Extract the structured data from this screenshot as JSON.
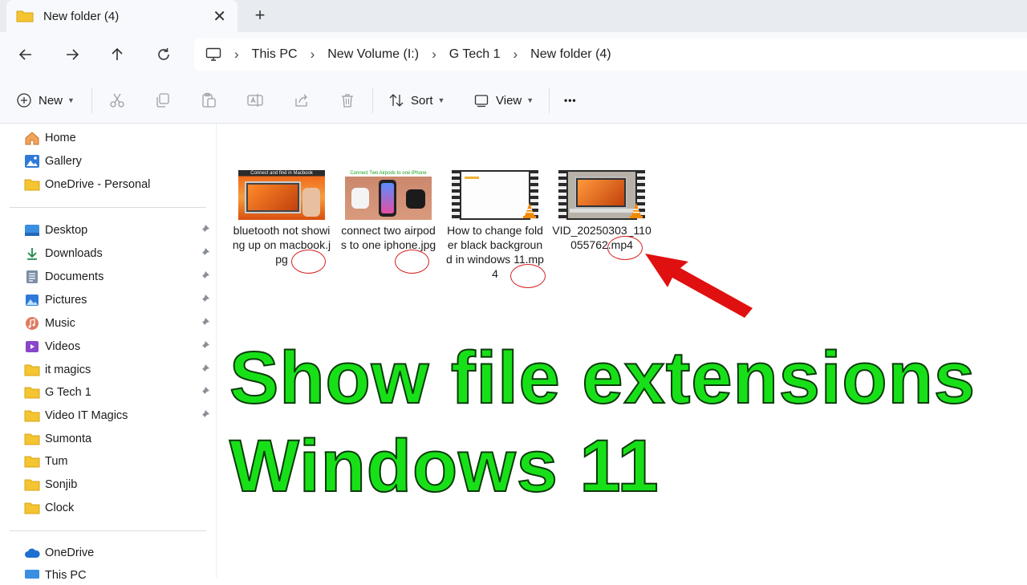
{
  "tab": {
    "title": "New folder (4)",
    "close": "✕",
    "new_tab": "+"
  },
  "address": {
    "crumbs": [
      "This PC",
      "New Volume (I:)",
      "G Tech 1",
      "New folder (4)"
    ],
    "separator": "›"
  },
  "toolbar": {
    "new_label": "New",
    "sort_label": "Sort",
    "view_label": "View",
    "more_label": "•••"
  },
  "sidebar": {
    "top_items": [
      {
        "label": "Home",
        "icon": "home-icon"
      },
      {
        "label": "Gallery",
        "icon": "gallery-icon"
      },
      {
        "label": "OneDrive - Personal",
        "icon": "folder-icon"
      }
    ],
    "pinned_items": [
      {
        "label": "Desktop",
        "icon": "desktop-icon",
        "pinned": true
      },
      {
        "label": "Downloads",
        "icon": "download-icon",
        "pinned": true
      },
      {
        "label": "Documents",
        "icon": "documents-icon",
        "pinned": true
      },
      {
        "label": "Pictures",
        "icon": "pictures-icon",
        "pinned": true
      },
      {
        "label": "Music",
        "icon": "music-icon",
        "pinned": true
      },
      {
        "label": "Videos",
        "icon": "videos-icon",
        "pinned": true
      },
      {
        "label": "it magics",
        "icon": "folder-icon",
        "pinned": true
      },
      {
        "label": "G Tech 1",
        "icon": "folder-icon",
        "pinned": true
      },
      {
        "label": "Video IT Magics",
        "icon": "folder-icon",
        "pinned": true
      },
      {
        "label": "Sumonta",
        "icon": "folder-icon",
        "pinned": false
      },
      {
        "label": "Tum",
        "icon": "folder-icon",
        "pinned": false
      },
      {
        "label": "Sonjib",
        "icon": "folder-icon",
        "pinned": false
      },
      {
        "label": "Clock",
        "icon": "folder-icon",
        "pinned": false
      }
    ],
    "bottom_items": [
      {
        "label": "OneDrive",
        "icon": "cloud-icon"
      },
      {
        "label": "This PC",
        "icon": "pc-icon"
      }
    ]
  },
  "files": [
    {
      "name": "bluetooth not showing up on macbook.jpg",
      "thumb_caption": "Connect and find in Macbook",
      "type": "jpg"
    },
    {
      "name": "connect two airpods to one iphone.jpg",
      "thumb_caption": "Connect Two Airpods to one iPhone",
      "type": "jpg"
    },
    {
      "name": "How to change folder black background in windows 11.mp4",
      "type": "mp4"
    },
    {
      "name": "VID_20250303_110055762.mp4",
      "type": "mp4"
    }
  ],
  "overlay": {
    "line1": "Show file extensions",
    "line2": "Windows 11"
  },
  "colors": {
    "overlay_text": "#18e018",
    "annotation_red": "#e01010",
    "folder_yellow": "#f4c431"
  }
}
